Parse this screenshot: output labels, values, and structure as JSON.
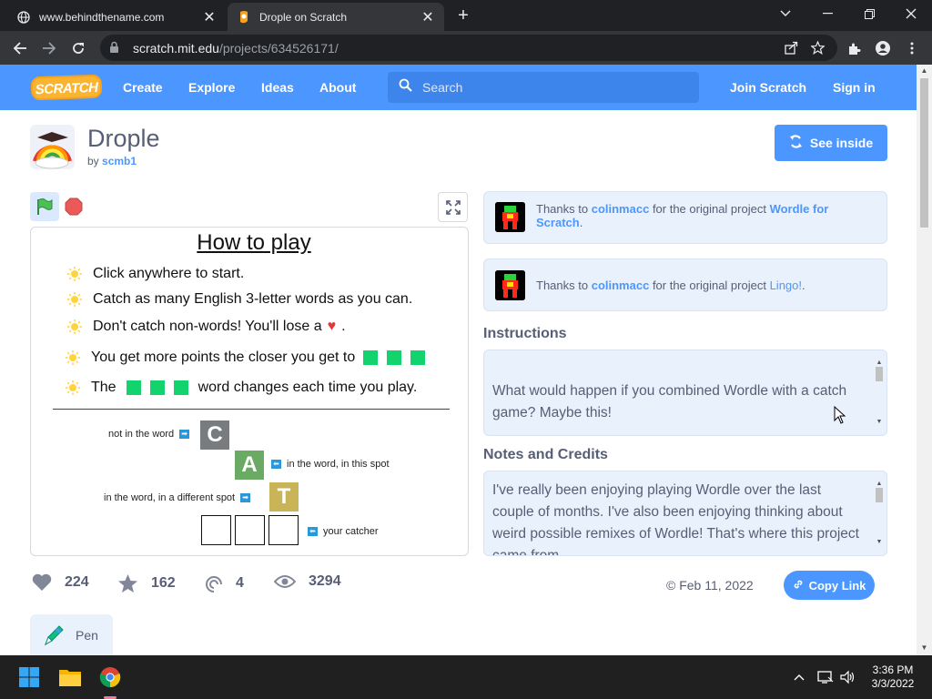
{
  "browser": {
    "tabs": [
      {
        "title": "www.behindthename.com",
        "active": false
      },
      {
        "title": "Drople on Scratch",
        "active": true
      }
    ],
    "url_host": "scratch.mit.edu",
    "url_path": "/projects/634526171/"
  },
  "nav": {
    "logo": "SCRATCH",
    "links": [
      "Create",
      "Explore",
      "Ideas",
      "About"
    ],
    "search_placeholder": "Search",
    "join": "Join Scratch",
    "signin": "Sign in"
  },
  "project": {
    "title": "Drople",
    "by_prefix": "by",
    "author": "scmb1",
    "see_inside": "See inside"
  },
  "stage": {
    "heading": "How to play",
    "rules": [
      "Click anywhere to start.",
      "Catch as many English 3-letter words as you can.",
      "Don't catch non-words! You'll lose a",
      "You get more points the closer you get to",
      "The",
      "word changes each time you play."
    ],
    "heart": "♥",
    "period": ".",
    "letters": [
      "C",
      "A",
      "T"
    ],
    "labels": {
      "not_in_word": "not in the word",
      "in_spot": "in the word, in this spot",
      "diff_spot": "in the word, in a different spot",
      "catcher": "your catcher"
    }
  },
  "credits": [
    {
      "prefix": "Thanks to",
      "user": "colinmacc",
      "mid": "for the original project",
      "project": "Wordle for Scratch",
      "suffix": "."
    },
    {
      "prefix": "Thanks to",
      "user": "colinmacc",
      "mid": "for the original project",
      "project": "Lingo!",
      "suffix": "."
    }
  ],
  "instructions": {
    "heading": "Instructions",
    "text": "What would happen if you combined Wordle with a catch game? Maybe this!\n\nIn Wordle, you try to minimize your guesses, but in"
  },
  "notes": {
    "heading": "Notes and Credits",
    "text": "I've really been enjoying playing Wordle over the last couple of months. I've also been enjoying thinking about weird possible remixes of Wordle! That's where this project came from."
  },
  "stats": {
    "loves": "224",
    "favorites": "162",
    "remixes": "4",
    "views": "3294",
    "date": "© Feb 11, 2022",
    "copy_link": "Copy Link"
  },
  "extension": {
    "label": "Pen"
  },
  "taskbar": {
    "time": "3:36 PM",
    "date": "3/3/2022"
  },
  "colors": {
    "scratch_blue": "#4c97ff",
    "green": "#13d36d",
    "gray_letter": "#787c7e",
    "yellow_letter": "#c9b458",
    "green_letter": "#6aaa64"
  }
}
